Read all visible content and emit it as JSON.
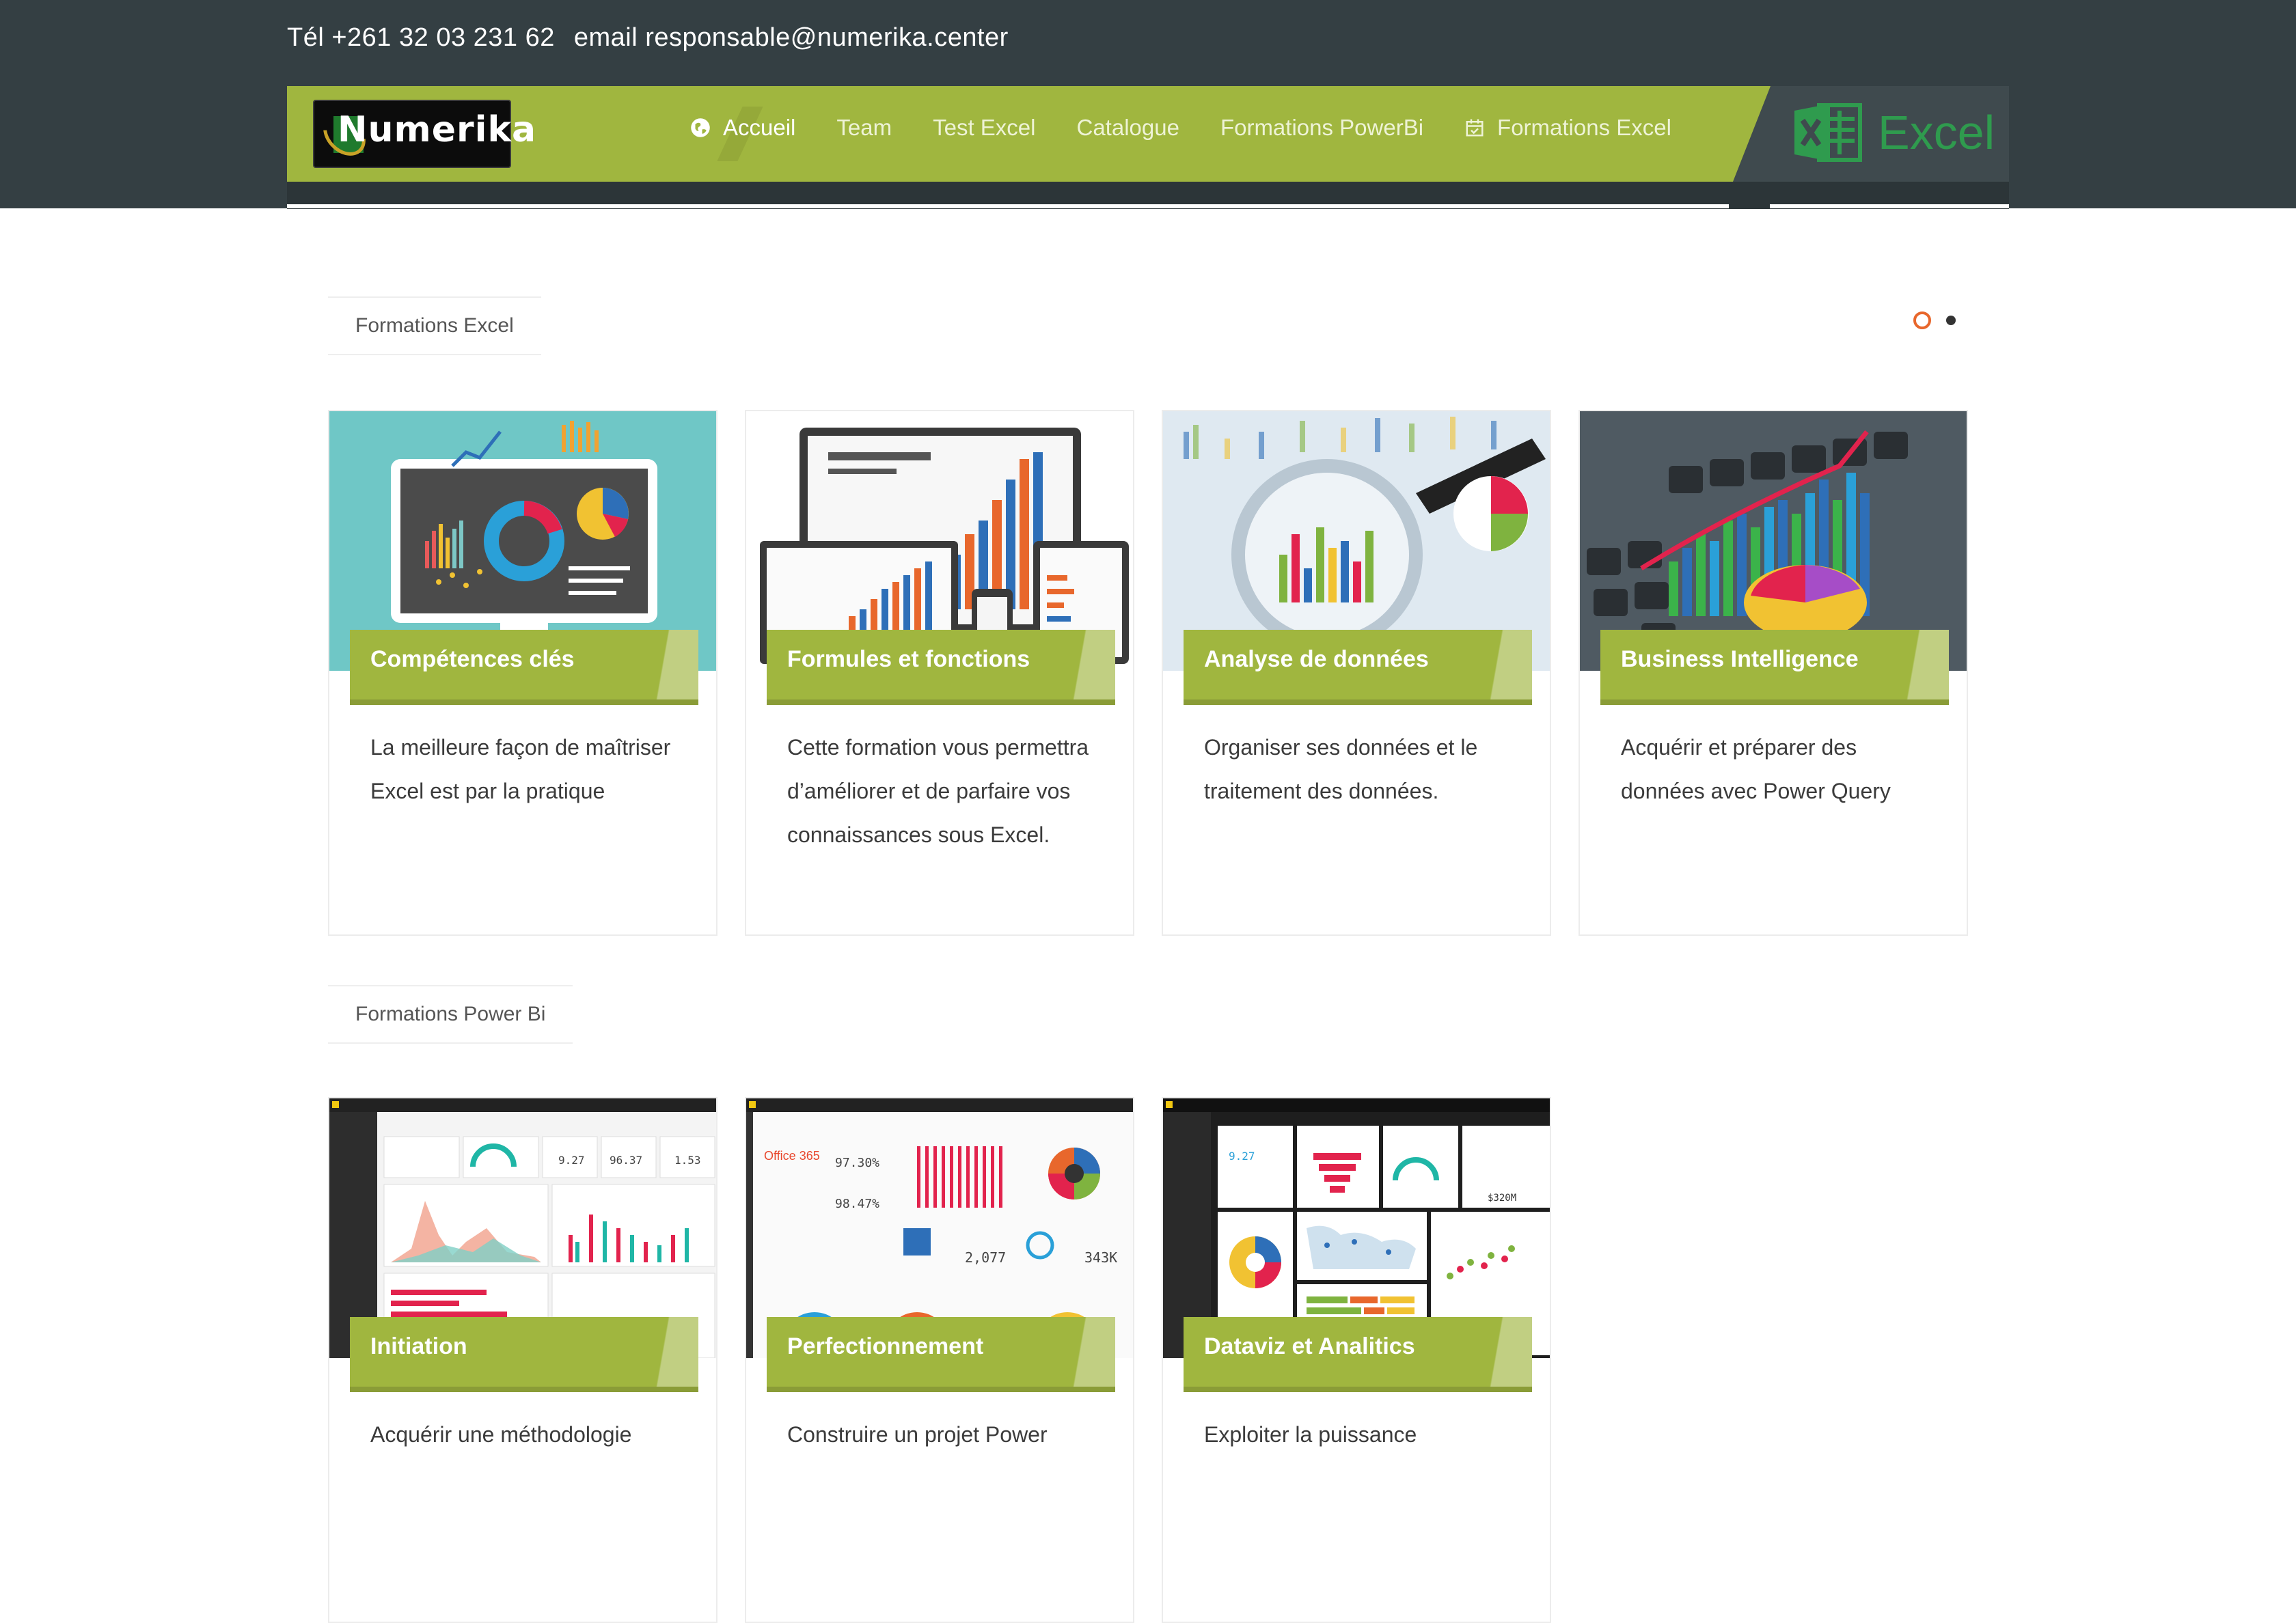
{
  "header": {
    "phone": "Tél +261 32 03 231 62",
    "email": "email responsable@numerika.center"
  },
  "logo": {
    "text": "Numerika"
  },
  "nav": {
    "items": [
      {
        "label": "Accueil",
        "icon": "globe-icon",
        "active": true
      },
      {
        "label": "Team"
      },
      {
        "label": "Test Excel"
      },
      {
        "label": "Catalogue"
      },
      {
        "label": "Formations PowerBi"
      },
      {
        "label": "Formations Excel",
        "icon": "calendar-icon"
      }
    ]
  },
  "excel_badge": {
    "text": "Excel",
    "icon": "excel-icon"
  },
  "sections": {
    "excel": {
      "title": "Formations Excel",
      "cards": [
        {
          "title": "Compétences clés",
          "description": "La meilleure façon de maîtriser Excel est par la pratique"
        },
        {
          "title": "Formules et fonctions",
          "description": "Cette formation vous permettra d’améliorer et de parfaire vos connaissances sous Excel."
        },
        {
          "title": "Analyse de données",
          "description": "Organiser ses données et le traitement des données."
        },
        {
          "title": "Business Intelligence",
          "description": "Acquérir et préparer des données avec Power Query"
        }
      ]
    },
    "powerbi": {
      "title": "Formations Power Bi",
      "cards": [
        {
          "title": "Initiation",
          "description": "Acquérir une méthodologie"
        },
        {
          "title": "Perfectionnement",
          "description": "Construire un projet Power"
        },
        {
          "title": "Dataviz et Analitics",
          "description": "Exploiter la puissance"
        }
      ]
    }
  },
  "dashboard_labels": {
    "office365": "Office 365",
    "pct1": "97.30%",
    "pct2": "98.47%",
    "num1": "2,077",
    "num2": "343K",
    "v1": "9.27",
    "v2": "96.37",
    "v3": "1.53",
    "v4": "$320M"
  },
  "colors": {
    "accent": "#a0b63f",
    "dark": "#343f43",
    "excel_green": "#2f9b4e",
    "slider_active": "#e8672c"
  }
}
